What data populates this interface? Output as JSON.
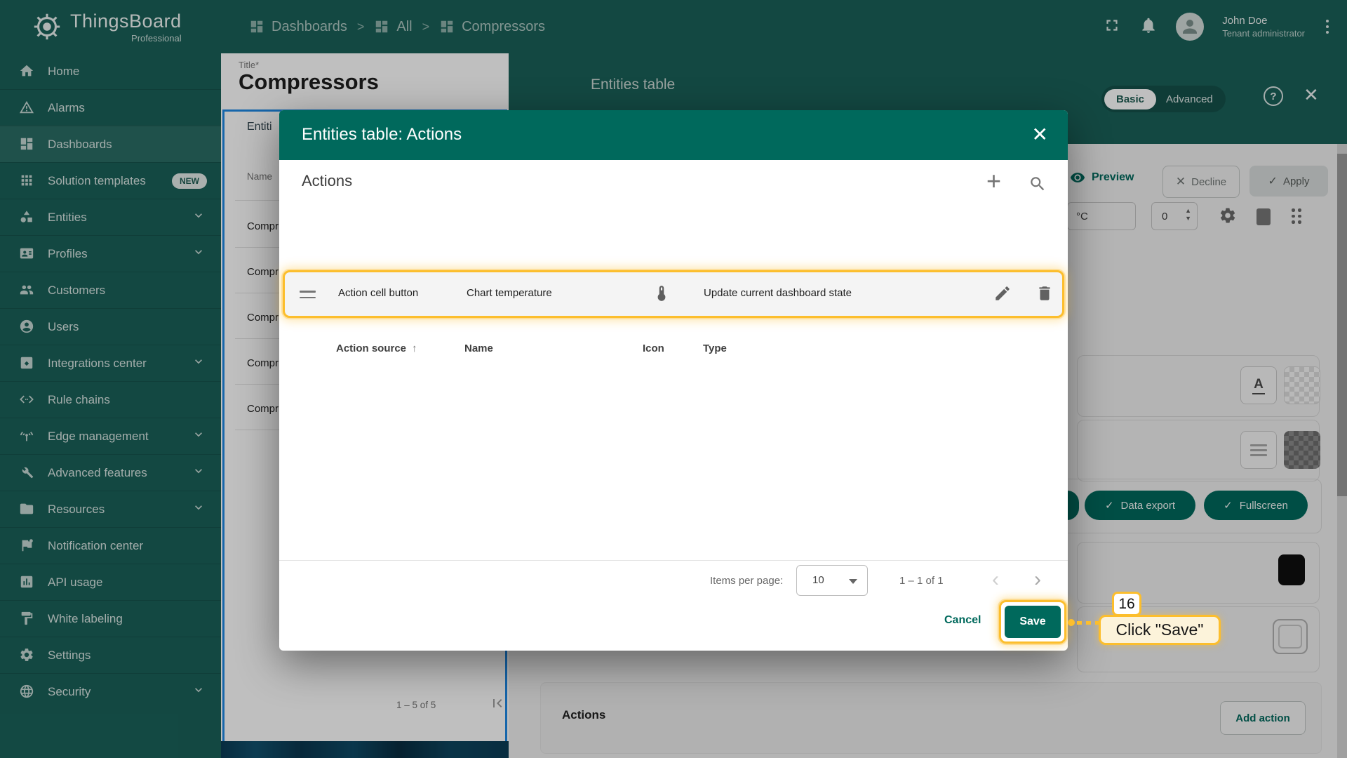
{
  "brand": {
    "name": "ThingsBoard",
    "edition": "Professional"
  },
  "breadcrumb": {
    "sep": ">",
    "items": [
      {
        "label": "Dashboards"
      },
      {
        "label": "All"
      },
      {
        "label": "Compressors"
      }
    ]
  },
  "topbar": {
    "user_name": "John Doe",
    "user_role": "Tenant administrator"
  },
  "sidebar": {
    "items": [
      {
        "label": "Home"
      },
      {
        "label": "Alarms"
      },
      {
        "label": "Dashboards"
      },
      {
        "label": "Solution templates",
        "badge": "NEW"
      },
      {
        "label": "Entities"
      },
      {
        "label": "Profiles"
      },
      {
        "label": "Customers"
      },
      {
        "label": "Users"
      },
      {
        "label": "Integrations center"
      },
      {
        "label": "Rule chains"
      },
      {
        "label": "Edge management"
      },
      {
        "label": "Advanced features"
      },
      {
        "label": "Resources"
      },
      {
        "label": "Notification center"
      },
      {
        "label": "API usage"
      },
      {
        "label": "White labeling"
      },
      {
        "label": "Settings"
      },
      {
        "label": "Security"
      }
    ]
  },
  "left_panel": {
    "title_label": "Title*",
    "title_value": "Compressors",
    "tab_label": "Entiti",
    "name_header": "Name",
    "rows": [
      {
        "name": "Compr"
      },
      {
        "name": "Compr"
      },
      {
        "name": "Compr"
      },
      {
        "name": "Compr"
      },
      {
        "name": "Compr"
      }
    ],
    "pagination": "1 – 5 of 5"
  },
  "right_panel": {
    "widget_title": "Entities table",
    "basic_label": "Basic",
    "advanced_label": "Advanced",
    "help_glyph": "?",
    "preview_label": "Preview",
    "decline_label": "Decline",
    "apply_label": "Apply",
    "unit_value": "°C",
    "number_value": "0",
    "data_export_label": "Data export",
    "fullscreen_label": "Fullscreen",
    "actions_title": "Actions",
    "add_action_label": "Add action",
    "text_format_glyph": "A"
  },
  "modal": {
    "title": "Entities table: Actions",
    "section_title": "Actions",
    "columns": {
      "source": "Action source",
      "name": "Name",
      "icon": "Icon",
      "type": "Type"
    },
    "rows": [
      {
        "source": "Action cell button",
        "name": "Chart temperature",
        "icon": "thermometer-icon",
        "type": "Update current dashboard state"
      }
    ],
    "paginator": {
      "label": "Items per page:",
      "per_page": "10",
      "range": "1 – 1 of 1"
    },
    "cancel_label": "Cancel",
    "save_label": "Save"
  },
  "annotation": {
    "step": "16",
    "label": "Click \"Save\""
  },
  "colors": {
    "teal": "#00695c",
    "sidebar_teal": "#1a6159",
    "amber": "#fcbe2d",
    "highlight_row_bg": "#f4f4f4"
  }
}
